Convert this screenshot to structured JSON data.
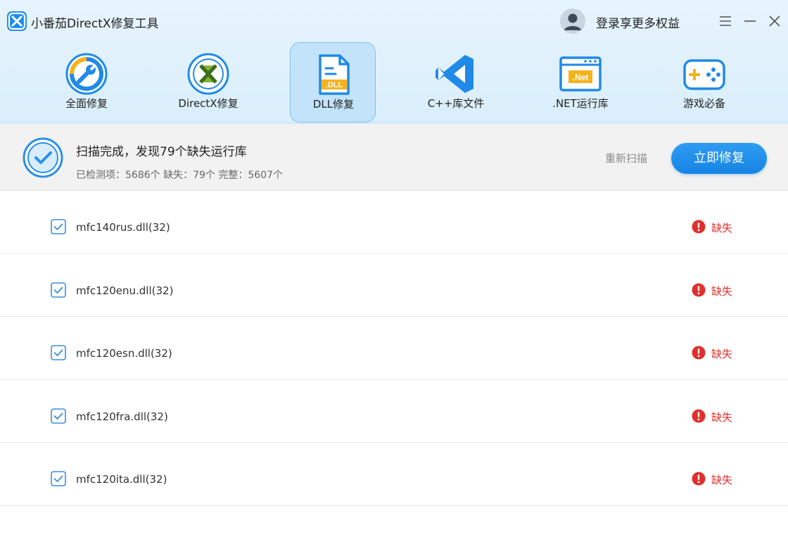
{
  "app": {
    "title": "小番茄DirectX修复工具",
    "login_text": "登录享更多权益"
  },
  "nav": {
    "active_index": 2,
    "items": [
      {
        "label": "全面修复",
        "icon": "wrench-icon"
      },
      {
        "label": "DirectX修复",
        "icon": "directx-icon"
      },
      {
        "label": "DLL修复",
        "icon": "dll-file-icon",
        "icon_text": ".DLL"
      },
      {
        "label": "C++库文件",
        "icon": "visual-studio-icon"
      },
      {
        "label": ".NET运行库",
        "icon": "dotnet-window-icon",
        "icon_text": ".Net"
      },
      {
        "label": "游戏必备",
        "icon": "gamepad-icon"
      }
    ]
  },
  "summary": {
    "title": "扫描完成，发现79个缺失运行库",
    "checked_label": "已检测项：",
    "checked_value": "5686个",
    "missing_label": "缺失：",
    "missing_value": "79个",
    "complete_label": "完整：",
    "complete_value": "5607个",
    "rescan_label": "重新扫描",
    "fix_label": "立即修复"
  },
  "files": [
    {
      "name": "mfc140rus.dll(32)",
      "status": "缺失",
      "checked": true
    },
    {
      "name": "mfc120enu.dll(32)",
      "status": "缺失",
      "checked": true
    },
    {
      "name": "mfc120esn.dll(32)",
      "status": "缺失",
      "checked": true
    },
    {
      "name": "mfc120fra.dll(32)",
      "status": "缺失",
      "checked": true
    },
    {
      "name": "mfc120ita.dll(32)",
      "status": "缺失",
      "checked": true
    }
  ],
  "colors": {
    "accent": "#1584e4",
    "missing": "#e0302c",
    "header_bg": "#dff0fc"
  }
}
